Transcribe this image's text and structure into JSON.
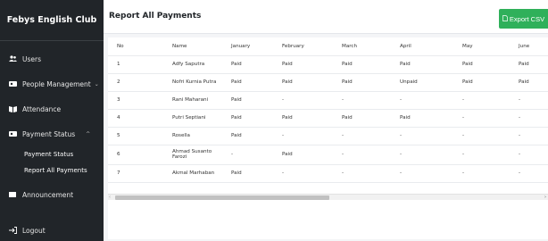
{
  "sidebar": {
    "brand": "Febys English Club",
    "items": [
      {
        "label": "Users",
        "icon": "users-icon"
      },
      {
        "label": "People Management",
        "icon": "people-icon",
        "chevron": "⌄"
      },
      {
        "label": "Attendance",
        "icon": "book-icon"
      },
      {
        "label": "Payment Status",
        "icon": "payment-icon",
        "chevron": "^"
      }
    ],
    "sub_items": [
      "Payment Status",
      "Report All Payments"
    ],
    "announcement": "Announcement",
    "logout": "Logout"
  },
  "header": {
    "title": "Report All Payments",
    "export_label": "Export CSV"
  },
  "table": {
    "columns": [
      "No",
      "Name",
      "January",
      "February",
      "March",
      "April",
      "May",
      "June"
    ],
    "rows": [
      [
        "1",
        "Adfy Saputra",
        "Paid",
        "Paid",
        "Paid",
        "Paid",
        "Paid",
        "Paid"
      ],
      [
        "2",
        "Nofri Kurnia Putra",
        "Paid",
        "Paid",
        "Paid",
        "Unpaid",
        "Paid",
        "Paid"
      ],
      [
        "3",
        "Rani Maharani",
        "Paid",
        "-",
        "-",
        "-",
        "-",
        "-"
      ],
      [
        "4",
        "Putri Septiani",
        "Paid",
        "Paid",
        "Paid",
        "Paid",
        "-",
        "-"
      ],
      [
        "5",
        "Rosella",
        "Paid",
        "-",
        "-",
        "-",
        "-",
        "-"
      ],
      [
        "6",
        "Ahmad Susanto Farozi",
        "-",
        "Paid",
        "-",
        "-",
        "-",
        "-"
      ],
      [
        "7",
        "Akmal Marhaban",
        "Paid",
        "-",
        "-",
        "-",
        "-",
        "-"
      ]
    ]
  },
  "scroll": {
    "left_arrow": "‹",
    "right_arrow": "›"
  },
  "colors": {
    "sidebar": "#212529",
    "export": "#2fb05a"
  }
}
